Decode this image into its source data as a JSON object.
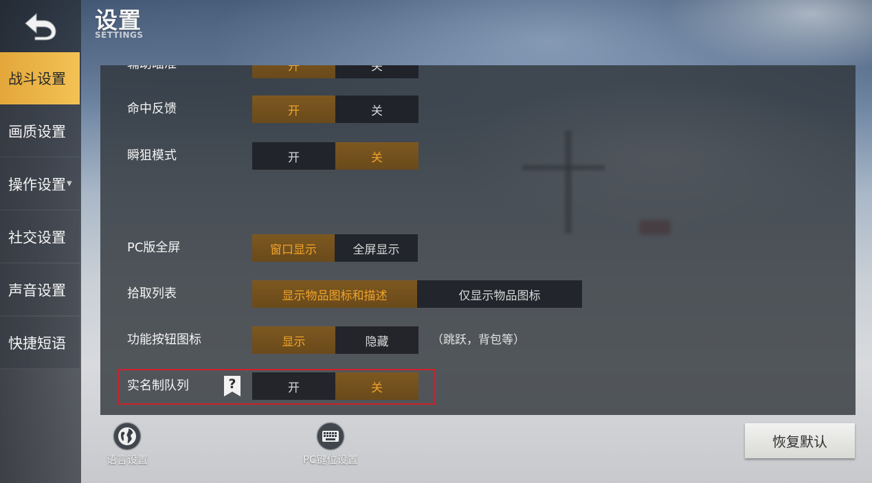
{
  "header": {
    "title": "设置",
    "subtitle": "SETTINGS"
  },
  "sidebar": {
    "items": [
      {
        "label": "战斗设置",
        "active": true
      },
      {
        "label": "画质设置"
      },
      {
        "label": "操作设置",
        "has_dropdown": true
      },
      {
        "label": "社交设置"
      },
      {
        "label": "声音设置"
      },
      {
        "label": "快捷短语"
      }
    ]
  },
  "settings": [
    {
      "label": "辅助瞄准",
      "options": [
        "开",
        "关"
      ],
      "selected": 0
    },
    {
      "label": "命中反馈",
      "options": [
        "开",
        "关"
      ],
      "selected": 0
    },
    {
      "label": "瞬狙模式",
      "options": [
        "开",
        "关"
      ],
      "selected": 1
    },
    {
      "label": "PC版全屏",
      "options": [
        "窗口显示",
        "全屏显示"
      ],
      "selected": 0
    },
    {
      "label": "拾取列表",
      "options": [
        "显示物品图标和描述",
        "仅显示物品图标"
      ],
      "selected": 0
    },
    {
      "label": "功能按钮图标",
      "options": [
        "显示",
        "隐藏"
      ],
      "selected": 0,
      "note": "（跳跃，背包等）"
    },
    {
      "label": "实名制队列",
      "options": [
        "开",
        "关"
      ],
      "selected": 1,
      "help_icon": "question-flag-icon",
      "highlighted": true
    }
  ],
  "bottom": {
    "language_label": "语言设置",
    "language_icon": "globe-icon",
    "pc_keys_label": "PC键位设置",
    "pc_keys_icon": "keyboard-icon",
    "reset_label": "恢复默认"
  },
  "colors": {
    "accent": "#f0a32a",
    "selected_bg": "#7d5820",
    "active_nav": "#f3c255",
    "highlight_border": "#d0202a"
  }
}
